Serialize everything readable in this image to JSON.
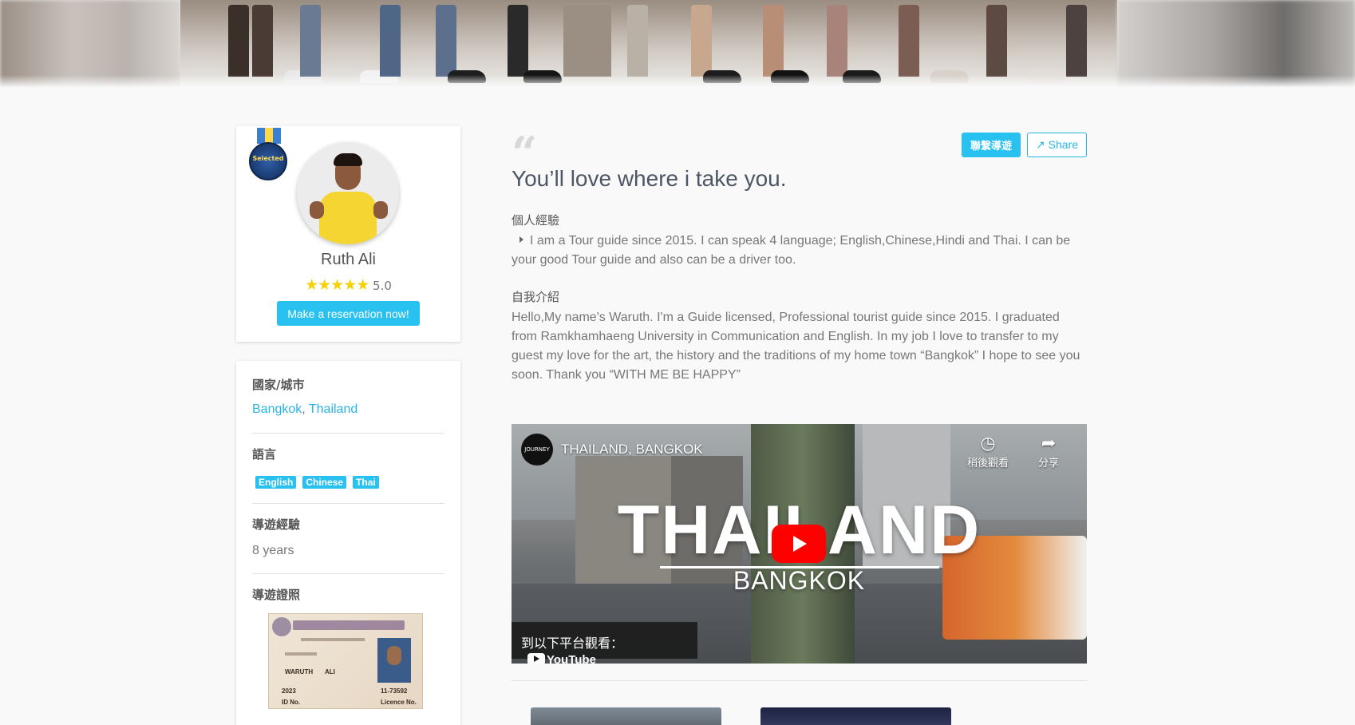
{
  "profile": {
    "badge_text": "Selected",
    "name": "Ruth Ali",
    "stars": "★★★★★",
    "rating": "5.0",
    "reserve_label": "Make a reservation now!"
  },
  "info": {
    "location_label": "國家/城市",
    "city": "Bangkok",
    "separator": ", ",
    "country": "Thailand",
    "language_label": "語言",
    "languages": [
      "English",
      "Chinese",
      "Thai"
    ],
    "experience_label": "導遊經驗",
    "experience_value": "8 years",
    "license_label": "導遊證照",
    "license_card": {
      "name": "WARUTH",
      "surname": "ALI",
      "year": "2023",
      "number": "11-73592",
      "id_label": "ID No.",
      "licence_label": "Licence No."
    }
  },
  "main": {
    "contact_label": "聯繫導遊",
    "share_label": "Share",
    "share_icon": "share-square-icon",
    "quote_icon": "quote-left-icon",
    "tagline": "You’ll love where i take you.",
    "experience_heading": "個人經驗",
    "experience_text": "I am a Tour guide since 2015. I can speak 4 language; English,Chinese,Hindi and Thai. I can be your good Tour guide and also can be a driver too.",
    "intro_heading": "自我介紹",
    "intro_text": "Hello,My name's Waruth. I'm a Guide licensed, Professional tourist guide since 2015. I graduated from Ramkhamhaeng University in Communication and English. In my job I love to transfer to my guest my love for the art, the history and the traditions of my home town “Bangkok” I hope to see you soon. Thank you “WITH ME BE HAPPY”"
  },
  "video": {
    "channel_logo_text": "JOURNEY",
    "title": "THAILAND, BANGKOK",
    "watch_later_label": "稍後觀看",
    "share_label": "分享",
    "big_title": "THAILAND",
    "big_subtitle": "BANGKOK",
    "watch_on_label": "到以下平台觀看：",
    "youtube_label": "YouTube"
  },
  "colors": {
    "accent": "#29c1f0",
    "link": "#29b4e8",
    "star": "#f5d10a",
    "youtube_red": "#ff0000"
  }
}
